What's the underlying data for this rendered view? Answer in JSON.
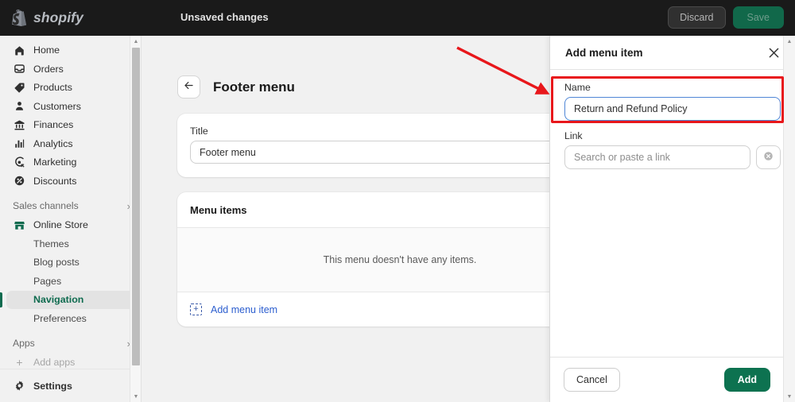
{
  "topbar": {
    "brand": "shopify",
    "brand_icon": "shopify-bag-icon",
    "status_text": "Unsaved changes",
    "discard_label": "Discard",
    "save_label": "Save",
    "background": "#1a1a1a",
    "save_color": "#11684a"
  },
  "sidebar": {
    "items": [
      {
        "label": "Home",
        "icon": "home-icon"
      },
      {
        "label": "Orders",
        "icon": "orders-inbox-icon"
      },
      {
        "label": "Products",
        "icon": "products-tag-icon"
      },
      {
        "label": "Customers",
        "icon": "customer-person-icon"
      },
      {
        "label": "Finances",
        "icon": "finances-bank-icon"
      },
      {
        "label": "Analytics",
        "icon": "analytics-bars-icon"
      },
      {
        "label": "Marketing",
        "icon": "marketing-megaphone-icon"
      },
      {
        "label": "Discounts",
        "icon": "discounts-tag-icon"
      }
    ],
    "sales_channels_label": "Sales channels",
    "sales_channels_chevron": "chevron-right-icon",
    "online_store": {
      "label": "Online Store",
      "icon": "online-store-icon"
    },
    "online_store_children": [
      {
        "label": "Themes"
      },
      {
        "label": "Blog posts"
      },
      {
        "label": "Pages"
      },
      {
        "label": "Navigation",
        "active": true
      },
      {
        "label": "Preferences"
      }
    ],
    "apps_label": "Apps",
    "apps_chevron": "chevron-right-icon",
    "add_apps_label": "Add apps",
    "add_apps_icon": "plus-icon",
    "settings_label": "Settings",
    "settings_icon": "gear-icon",
    "active_color": "#0f6b4f"
  },
  "main": {
    "back_icon": "arrow-left-icon",
    "page_title": "Footer menu",
    "title_card": {
      "label": "Title",
      "value": "Footer menu"
    },
    "menu_items_card": {
      "heading": "Menu items",
      "empty_text": "This menu doesn't have any items.",
      "add_label": "Add menu item",
      "add_icon": "plus-square-dashed-icon",
      "add_link_color": "#2c5ecf"
    }
  },
  "drawer": {
    "title": "Add menu item",
    "close_icon": "close-x-icon",
    "name_label": "Name",
    "name_value": "Return and Refund Policy",
    "link_label": "Link",
    "link_placeholder": "Search or paste a link",
    "link_value": "",
    "clear_icon": "clear-circle-x-icon",
    "cancel_label": "Cancel",
    "add_label": "Add",
    "add_button_color": "#0d7250",
    "focus_ring_color": "#4f86d6"
  },
  "annotations": {
    "highlight_color": "#e8171b",
    "box_target": "name-field",
    "arrow_target": "name-field"
  }
}
